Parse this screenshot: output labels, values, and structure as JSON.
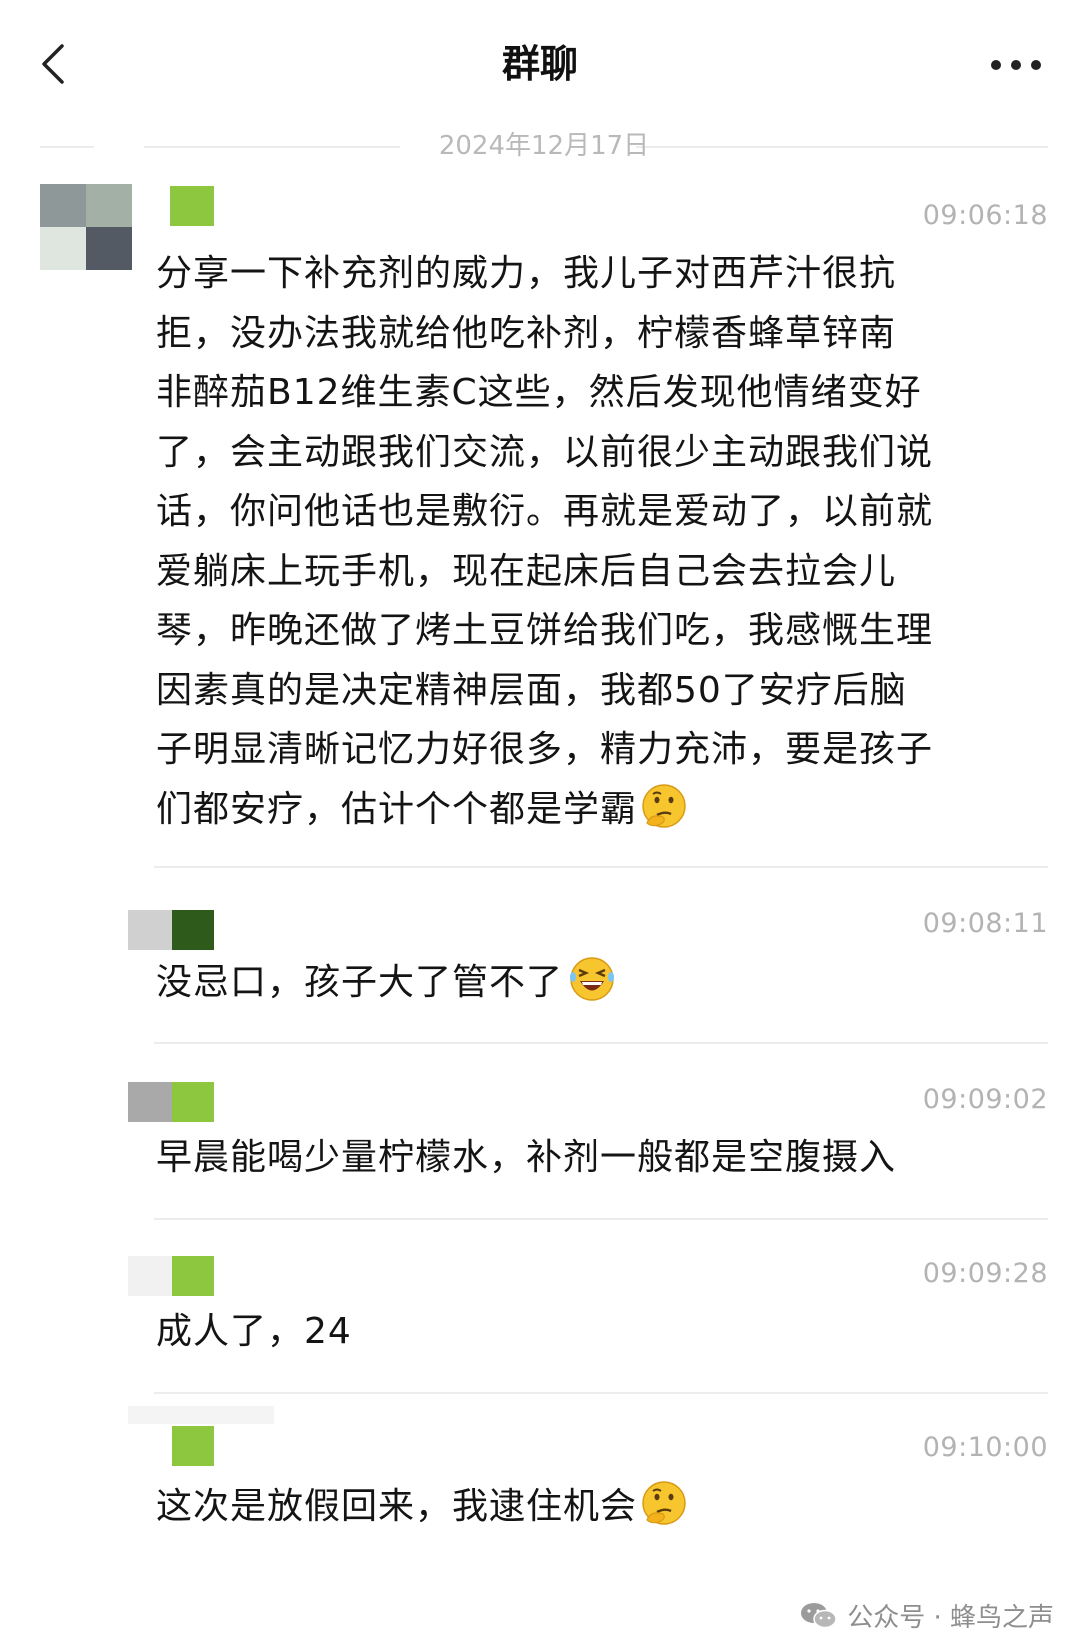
{
  "header": {
    "title": "群聊",
    "back_icon": "chevron-left-icon",
    "more_icon": "more-dots-icon"
  },
  "date_divider": "2024年12月17日",
  "messages": [
    {
      "time": "09:06:18",
      "text": "分享一下补充剂的威力，我儿子对西芹汁很抗\n拒，没办法我就给他吃补剂，柠檬香蜂草锌南\n非醉茄B12维生素C这些，然后发现他情绪变好\n了，会主动跟我们交流，以前很少主动跟我们说\n话，你问他话也是敷衍。再就是爱动了，以前就\n爱躺床上玩手机，现在起床后自己会去拉会儿\n琴，昨晚还做了烤土豆饼给我们吃，我感慨生理\n因素真的是决定精神层面，我都50了安疗后脑\n子明显清晰记忆力好很多，精力充沛，要是孩子\n们都安疗，估计个个都是学霸",
      "emoji": "thinking-face-icon"
    },
    {
      "time": "09:08:11",
      "text": "没忌口，孩子大了管不了",
      "emoji": "laughing-face-icon"
    },
    {
      "time": "09:09:02",
      "text": "早晨能喝少量柠檬水，补剂一般都是空腹摄入",
      "emoji": ""
    },
    {
      "time": "09:09:28",
      "text": "成人了，24",
      "emoji": ""
    },
    {
      "time": "09:10:00",
      "text": "这次是放假回来，我逮住机会",
      "emoji": "thinking-face-icon"
    }
  ],
  "watermark": "公众号 · 蜂鸟之声",
  "colors": {
    "accent_green": "#8dc63f",
    "dark_green": "#2e5a1c",
    "timestamp_gray": "#b3b3b3",
    "divider": "#ededed"
  }
}
